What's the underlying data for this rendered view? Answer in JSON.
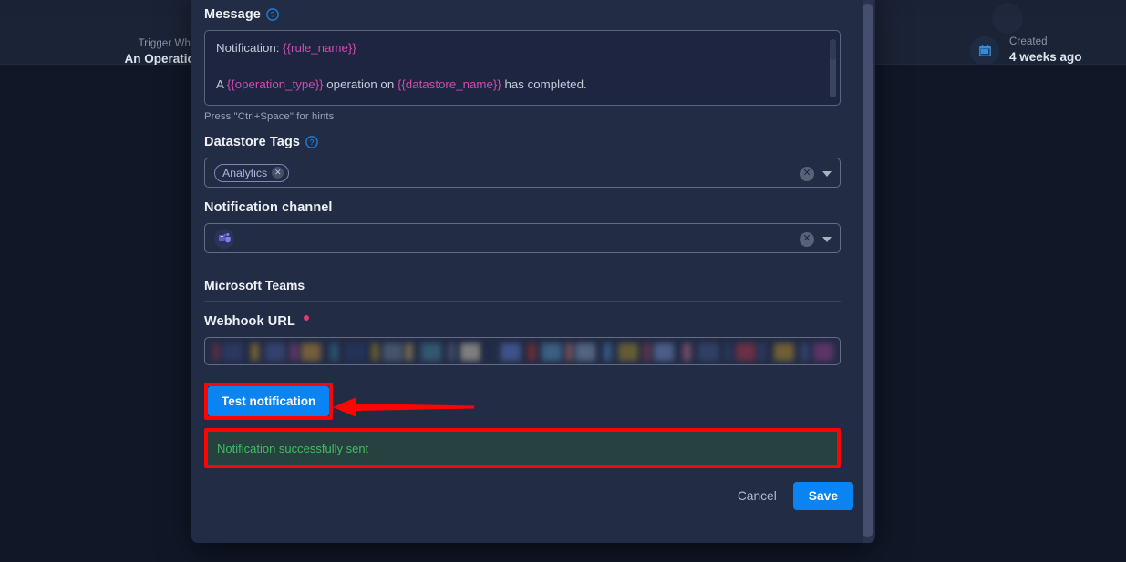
{
  "background": {
    "trigger": {
      "label": "Trigger When",
      "value": "An Operation"
    },
    "created": {
      "label": "Created",
      "value": "4 weeks ago",
      "icon": "calendar-icon"
    }
  },
  "modal": {
    "message": {
      "label": "Message",
      "help_icon": "help-circle-icon",
      "line1_prefix": "Notification: ",
      "line1_var": "{{rule_name}}",
      "line2_a": "A ",
      "line2_var1": "{{operation_type}}",
      "line2_b": " operation on ",
      "line2_var2": "{{datastore_name}}",
      "line2_c": " has completed.",
      "hint": "Press \"Ctrl+Space\" for hints"
    },
    "datastore_tags": {
      "label": "Datastore Tags",
      "help_icon": "help-circle-icon",
      "chips": [
        "Analytics"
      ],
      "clear_icon": "clear-circle-icon",
      "caret_icon": "chevron-down-icon"
    },
    "notification_channel": {
      "label": "Notification channel",
      "selected": "Microsoft Teams",
      "channel_icon": "microsoft-teams-icon",
      "clear_icon": "clear-circle-icon",
      "caret_icon": "chevron-down-icon"
    },
    "section": {
      "title": "Microsoft Teams"
    },
    "webhook": {
      "label": "Webhook URL",
      "required": true,
      "value_redacted": "••••••••••••••••••••••••••••"
    },
    "test": {
      "label": "Test notification"
    },
    "success": {
      "message": "Notification successfully sent"
    },
    "footer": {
      "cancel": "Cancel",
      "save": "Save"
    }
  },
  "annotations": {
    "highlight_color": "#fb0505",
    "arrow_color": "#fb0505",
    "accent_color": "#0a84f2",
    "success_color": "#3fbf5e",
    "variable_color": "#d34ab0"
  }
}
